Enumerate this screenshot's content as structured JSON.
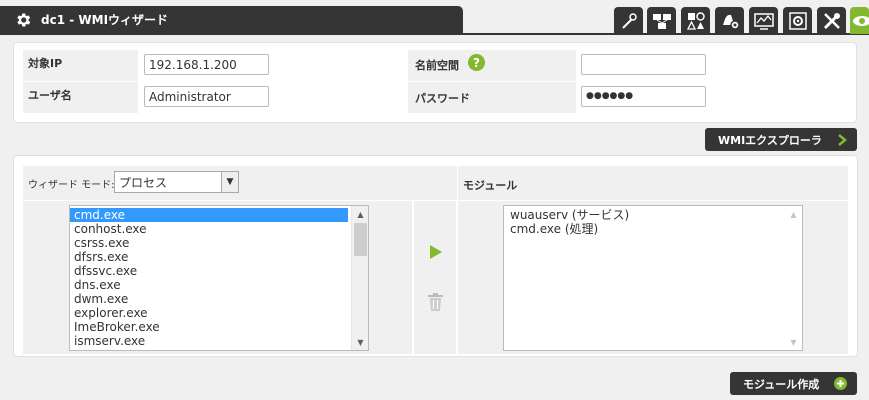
{
  "header": {
    "title": "dc1 - WMIウィザード",
    "tools": [
      "wand-icon",
      "network-icon",
      "shapes-icon",
      "bell-gear-icon",
      "monitor-chart-icon",
      "gear-box-icon",
      "tools-icon",
      "eye-icon"
    ]
  },
  "form": {
    "target_ip_label": "対象IP",
    "target_ip_value": "192.168.1.200",
    "namespace_label": "名前空間",
    "namespace_value": "",
    "username_label": "ユーザ名",
    "username_value": "Administrator",
    "password_label": "パスワード",
    "password_value": "●●●●●●"
  },
  "wmi_explorer_label": "WMIエクスプローラ",
  "wizard": {
    "mode_label": "ウィザード モード:",
    "mode_value": "プロセス",
    "modules_label": "モジュール",
    "processes": [
      "cmd.exe",
      "conhost.exe",
      "csrss.exe",
      "dfsrs.exe",
      "dfssvc.exe",
      "dns.exe",
      "dwm.exe",
      "explorer.exe",
      "ImeBroker.exe",
      "ismserv.exe"
    ],
    "selected_process": "cmd.exe",
    "modules": [
      "wuauserv (サービス)",
      "cmd.exe (処理)"
    ]
  },
  "create_module_label": "モジュール作成",
  "colors": {
    "dark": "#353535",
    "accent": "#82b92e",
    "selection": "#3399ff"
  }
}
